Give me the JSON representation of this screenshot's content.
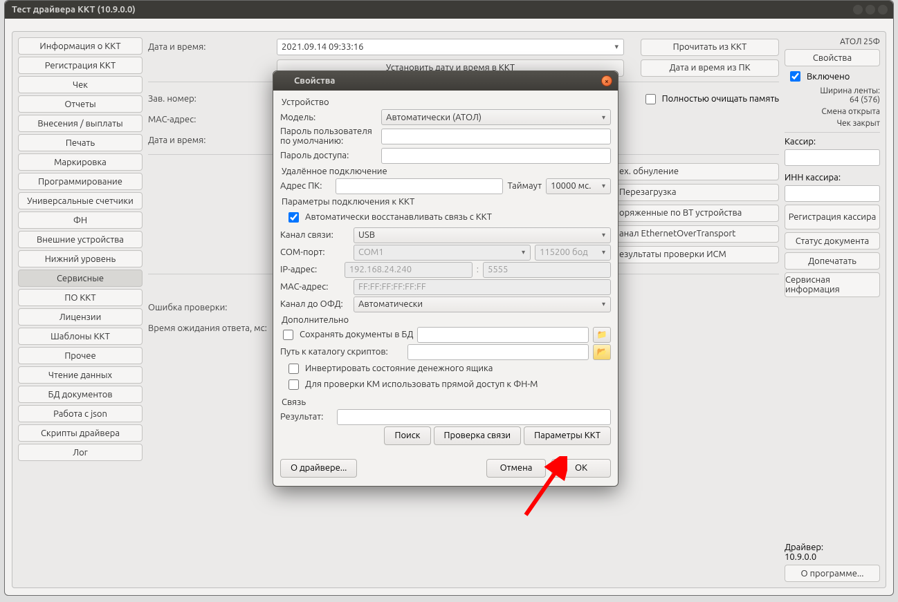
{
  "window_title": "Тест драйвера ККТ (10.9.0.0)",
  "sidebar": {
    "items": [
      "Информация о ККТ",
      "Регистрация ККТ",
      "Чек",
      "Отчеты",
      "Внесения / выплаты",
      "Печать",
      "Маркировка",
      "Программирование",
      "Универсальные счетчики",
      "ФН",
      "Внешние устройства",
      "Нижний уровень",
      "Сервисные",
      "ПО ККТ",
      "Лицензии",
      "Шаблоны ККТ",
      "Прочее",
      "Чтение данных",
      "БД документов",
      "Работа с json",
      "Скрипты драйвера",
      "Лог"
    ],
    "active_index": 12
  },
  "main": {
    "datetime_label": "Дата и время:",
    "datetime_value": "2021.09.14 09:33:16",
    "read_kkt": "Прочитать из ККТ",
    "set_datetime_label": "Установить дату и время в ККТ",
    "dt_from_pc": "Дата и время из ПК",
    "serial_label": "Зав. номер:",
    "mac_label": "MAC-адрес:",
    "datetime2_label": "Дата и время:",
    "clear_mem_check": "Полностью очищать память",
    "row_buttons": [
      "ех. обнуление",
      "Перезагрузка",
      "оряженные по BT устройства",
      "анал EthernetOverTransport",
      "езультаты проверки ИСМ"
    ],
    "err_label": "Ошибка проверки:",
    "timeout_label": "Время ожидания ответа, мс:"
  },
  "right": {
    "device": "АТОЛ 25Ф",
    "props": "Свойства",
    "enabled": "Включено",
    "tape": "Ширина ленты:\n64 (576)",
    "shift": "Смена открыта",
    "receipt": "Чек закрыт",
    "cashier": "Кассир:",
    "inn": "ИНН кассира:",
    "reg": "Регистрация кассира",
    "docstat": "Статус документа",
    "reprint": "Допечатать",
    "servinfo": "Сервисная информация",
    "driver": "Драйвер:\n10.9.0.0",
    "about": "О программе..."
  },
  "dialog": {
    "title": "Свойства",
    "s_device": "Устройство",
    "model": "Модель:",
    "model_v": "Автоматически (АТОЛ)",
    "pwd_user": "Пароль пользователя по умолчанию:",
    "pwd_access": "Пароль доступа:",
    "s_remote": "Удалённое подключение",
    "addr": "Адрес ПК:",
    "timeout": "Таймаут",
    "timeout_v": "10000 мс.",
    "s_conn": "Параметры подключения к ККТ",
    "auto": "Автоматически восстанавливать связь с ККТ",
    "chan": "Канал связи:",
    "chan_v": "USB",
    "com": "COM-порт:",
    "com_v": "COM1",
    "baud_v": "115200 бод",
    "ip": "IP-адрес:",
    "ip_v": "192.168.24.240",
    "port_v": "5555",
    "mac": "MAC-адрес:",
    "mac_v": "FF:FF:FF:FF:FF:FF",
    "ofd": "Канал до ОФД:",
    "ofd_v": "Автоматически",
    "s_extra": "Дополнительно",
    "savedb": "Сохранять документы в БД",
    "scriptdir": "Путь к каталогу скриптов:",
    "invert": "Инвертировать состояние денежного ящика",
    "fnmark": "Для проверки КМ использовать прямой доступ к ФН-М",
    "s_link": "Связь",
    "result": "Результат:",
    "search": "Поиск",
    "check": "Проверка связи",
    "params": "Параметры ККТ",
    "about": "О драйвере...",
    "cancel": "Отмена",
    "ok": "ОК"
  }
}
